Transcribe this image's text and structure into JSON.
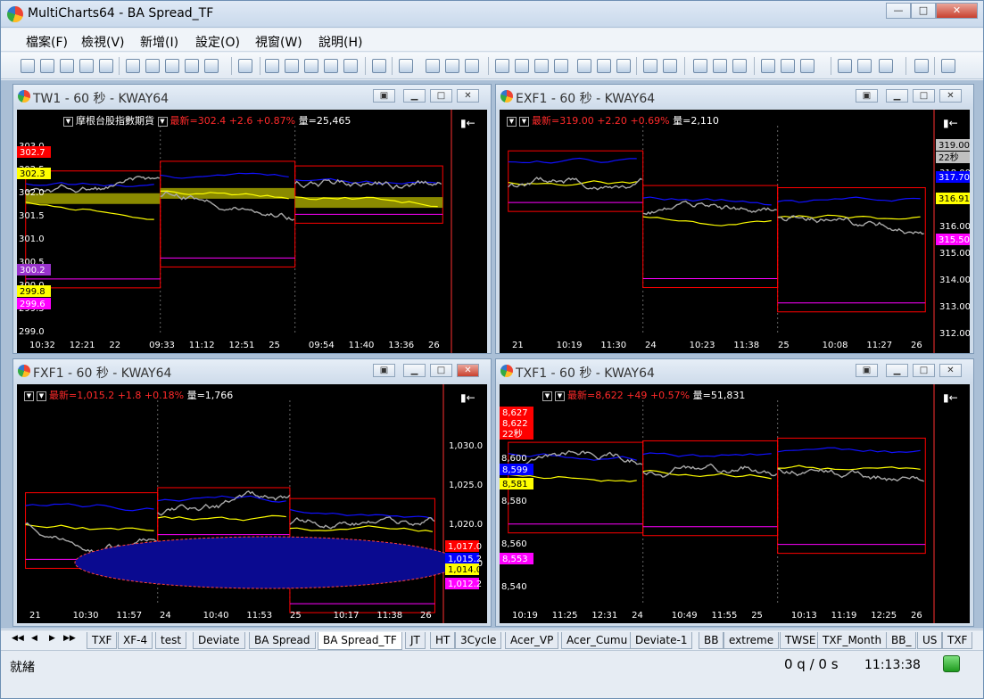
{
  "window": {
    "title": "MultiCharts64 - BA Spread_TF",
    "minimize": "—",
    "maximize": "□",
    "close": "✕"
  },
  "menu": [
    "檔案(F)",
    "檢視(V)",
    "新增(I)",
    "設定(O)",
    "視窗(W)",
    "說明(H)"
  ],
  "chart_windows": [
    {
      "key": "tw1",
      "title": "TW1 - 60 秒 - KWAY64",
      "symbol_name": "摩根台股指數期貨",
      "last": "最新=302.4",
      "change": "+2.6",
      "pct": "+0.87%",
      "volume": "量=25,465",
      "y_ticks": [
        "303.0",
        "302.5",
        "302.0",
        "301.5",
        "301.0",
        "300.5",
        "300.0",
        "299.5",
        "299.0"
      ],
      "x_ticks": [
        "10:32",
        "12:21",
        "22",
        "09:33",
        "11:12",
        "12:51",
        "25",
        "09:54",
        "11:40",
        "13:36",
        "26"
      ],
      "price_tags": [
        {
          "text": "302.7",
          "color": "#ff0000"
        },
        {
          "text": "302.3",
          "color": "#ffff00"
        },
        {
          "text": "300.2",
          "color": "#9933cc"
        },
        {
          "text": "299.8",
          "color": "#ffff00"
        },
        {
          "text": "299.6",
          "color": "#ff00ff"
        }
      ]
    },
    {
      "key": "exf1",
      "title": "EXF1 - 60 秒 - KWAY64",
      "last": "最新=319.00",
      "change": "+2.20",
      "pct": "+0.69%",
      "volume": "量=2,110",
      "y_ticks": [
        "319.00",
        "318.00",
        "317.00",
        "316.00",
        "315.00",
        "314.00",
        "313.00",
        "312.00"
      ],
      "x_ticks": [
        "21",
        "10:19",
        "11:30",
        "24",
        "10:23",
        "11:38",
        "25",
        "10:08",
        "11:27",
        "26"
      ],
      "price_tags": [
        {
          "text": "319.00",
          "color": "#c0c0c0"
        },
        {
          "text": "22秒",
          "color": "#c0c0c0"
        },
        {
          "text": "317.70",
          "color": "#0000ff"
        },
        {
          "text": "316.91",
          "color": "#ffff00"
        },
        {
          "text": "315.50",
          "color": "#ff00ff"
        }
      ]
    },
    {
      "key": "fxf1",
      "title": "FXF1 - 60 秒 - KWAY64",
      "last": "最新=1,015.2",
      "change": "+1.8",
      "pct": "+0.18%",
      "volume": "量=1,766",
      "y_ticks": [
        "1,030.0",
        "1,025.0",
        "1,020.0",
        "1,015.0"
      ],
      "x_ticks": [
        "21",
        "10:30",
        "11:57",
        "24",
        "10:40",
        "11:53",
        "25",
        "10:17",
        "11:38",
        "26"
      ],
      "price_tags": [
        {
          "text": "1,017.0",
          "color": "#ff0000"
        },
        {
          "text": "1,015.2",
          "color": "#0000ff"
        },
        {
          "text": "1,014.0",
          "color": "#ffff00"
        },
        {
          "text": "1,012.2",
          "color": "#ff00ff"
        }
      ]
    },
    {
      "key": "txf1",
      "title": "TXF1 - 60 秒 - KWAY64",
      "last": "最新=8,622",
      "change": "+49",
      "pct": "+0.57%",
      "volume": "量=51,831",
      "y_ticks": [
        "8,620",
        "8,600",
        "8,580",
        "8,560",
        "8,540"
      ],
      "x_ticks": [
        "10:19",
        "11:25",
        "12:31",
        "24",
        "10:49",
        "11:55",
        "25",
        "10:13",
        "11:19",
        "12:25",
        "26"
      ],
      "price_tags": [
        {
          "text": "8,627",
          "color": "#ff0000"
        },
        {
          "text": "8,622",
          "color": "#ff0000"
        },
        {
          "text": "22秒",
          "color": "#ff0000"
        },
        {
          "text": "8,599",
          "color": "#0000ff"
        },
        {
          "text": "8,581",
          "color": "#ffff00"
        },
        {
          "text": "8,553",
          "color": "#ff00ff"
        }
      ]
    }
  ],
  "tabs": [
    "TXF",
    "XF-4",
    "test",
    "Deviate",
    "BA Spread",
    "BA Spread_TF",
    "JT",
    "HT",
    "3Cycle",
    "Acer_VP",
    "Acer_Cumu",
    "Deviate-1",
    "BB",
    "extreme",
    "TWSE",
    "TXF_Month",
    "BB_",
    "US",
    "TXF"
  ],
  "active_tab": "BA Spread_TF",
  "status": {
    "left": "就緒",
    "queue": "0 q / 0 s",
    "clock": "11:13:38",
    "connected_color": "#22aa22"
  },
  "colors": {
    "red": "#ff0000",
    "blue": "#1010ff",
    "yellow": "#ffff00",
    "magenta": "#ff00ff",
    "grey": "#a9a9a9",
    "olive": "#8a8a00",
    "navy": "#0a0a90"
  }
}
